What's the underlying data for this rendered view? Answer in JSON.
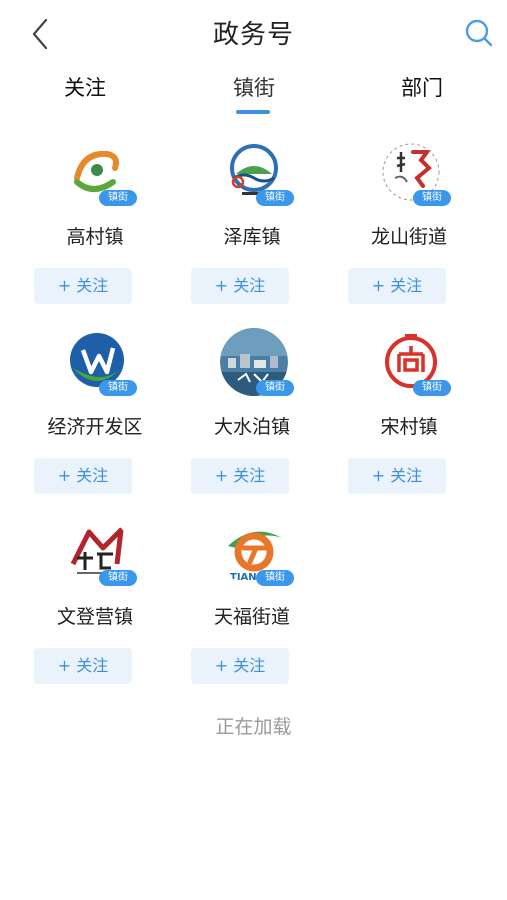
{
  "header": {
    "title": "政务号",
    "back_icon": "chevron-left-icon",
    "search_icon": "search-icon"
  },
  "tabs": [
    {
      "label": "关注",
      "active": false
    },
    {
      "label": "镇街",
      "active": true
    },
    {
      "label": "部门",
      "active": false
    }
  ],
  "accent_color": "#3e8fe0",
  "badge_text": "镇街",
  "follow_label": "+ 关注",
  "items": [
    {
      "name": "高村镇",
      "logo": "gaocun-logo"
    },
    {
      "name": "泽库镇",
      "logo": "zeku-logo"
    },
    {
      "name": "龙山街道",
      "logo": "longshan-logo"
    },
    {
      "name": "经济开发区",
      "logo": "kaifaqu-logo"
    },
    {
      "name": "大水泊镇",
      "logo": "dashuibo-logo"
    },
    {
      "name": "宋村镇",
      "logo": "songcun-logo"
    },
    {
      "name": "文登营镇",
      "logo": "wendengying-logo"
    },
    {
      "name": "天福街道",
      "logo": "tianfu-logo"
    }
  ],
  "loading_text": "正在加载"
}
